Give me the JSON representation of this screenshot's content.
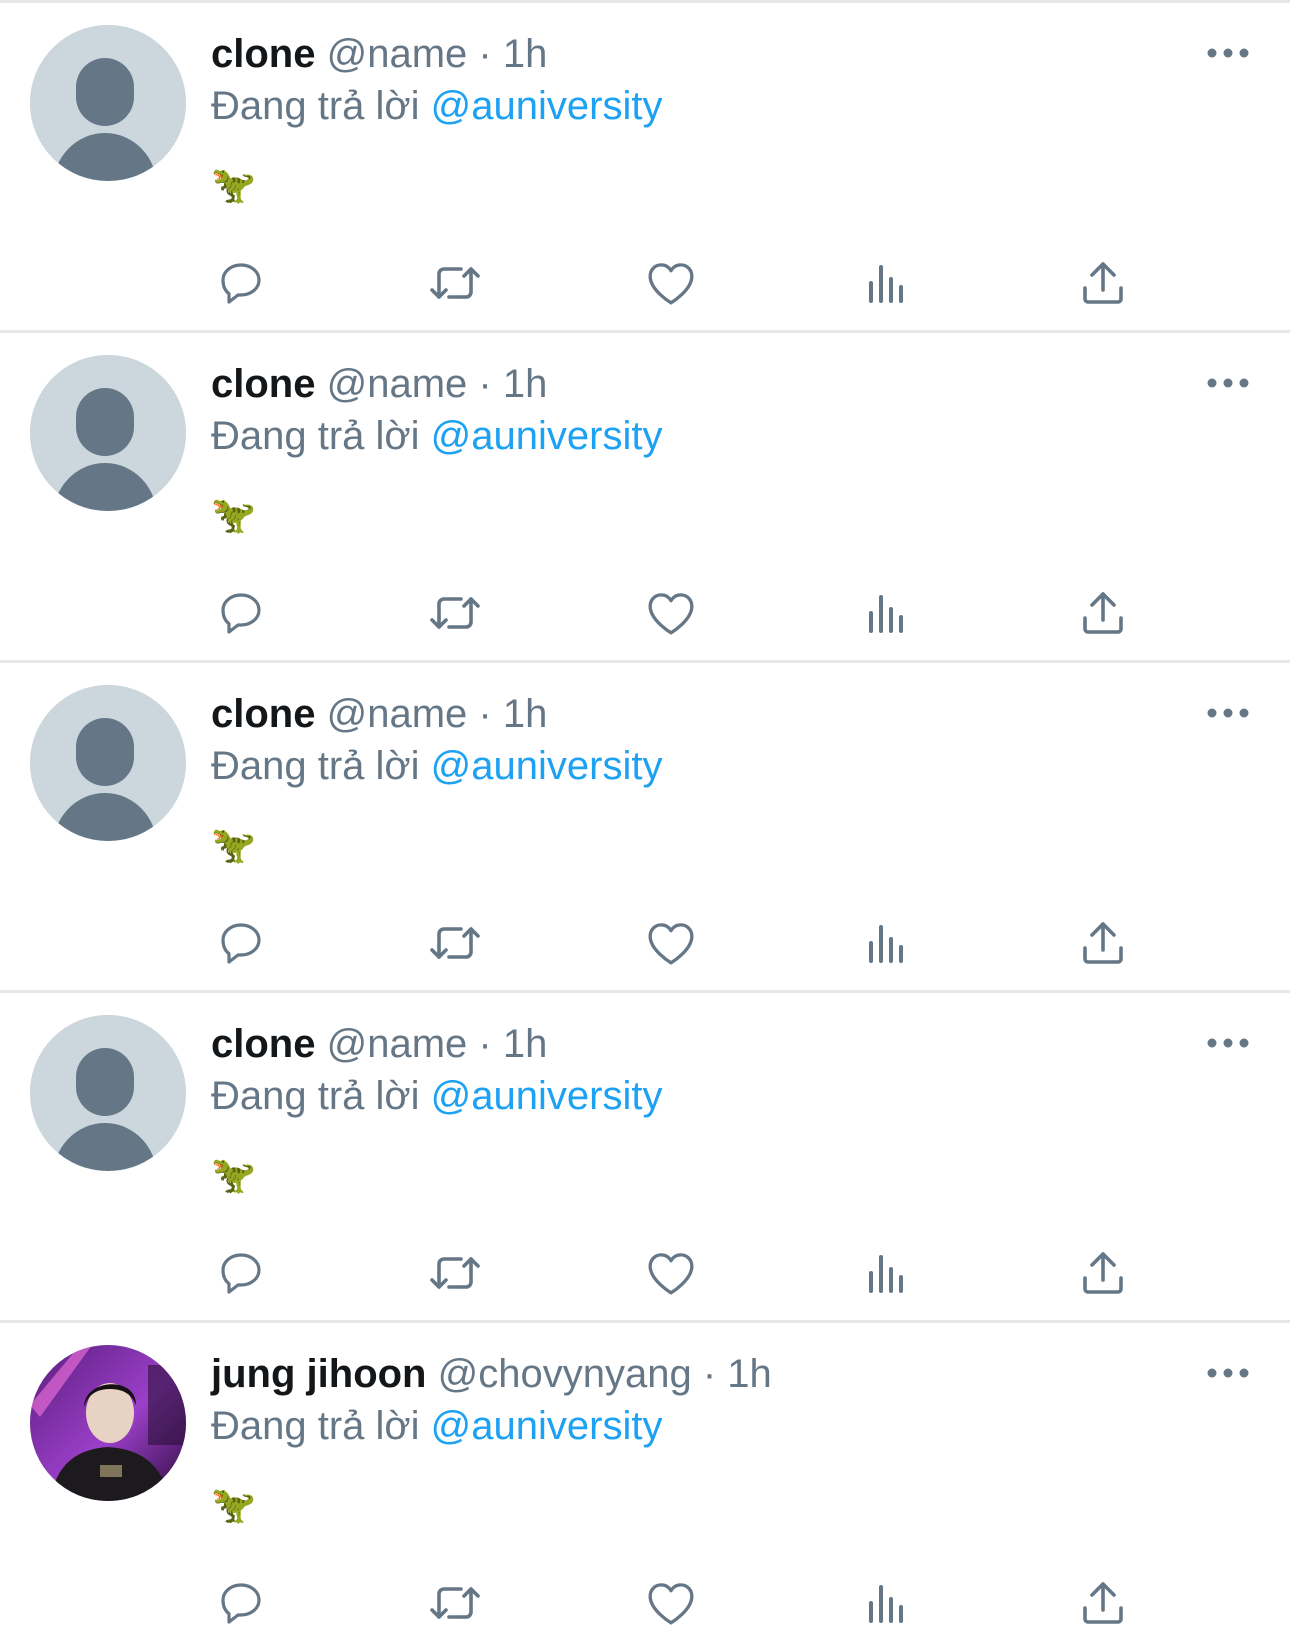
{
  "colors": {
    "text_primary": "#14171a",
    "text_secondary": "#657786",
    "link": "#1da1f2",
    "divider": "#e6e9ec",
    "avatar_placeholder_bg": "#ccd6dd",
    "avatar_placeholder_fg": "#657786"
  },
  "tweets": [
    {
      "display_name": "clone",
      "handle": "@name",
      "separator": "·",
      "time": "1h",
      "reply_prefix": "Đang trả lời",
      "reply_to": "@auniversity",
      "body": "🦖",
      "avatar": "default-profile-avatar"
    },
    {
      "display_name": "clone",
      "handle": "@name",
      "separator": "·",
      "time": "1h",
      "reply_prefix": "Đang trả lời",
      "reply_to": "@auniversity",
      "body": "🦖",
      "avatar": "default-profile-avatar"
    },
    {
      "display_name": "clone",
      "handle": "@name",
      "separator": "·",
      "time": "1h",
      "reply_prefix": "Đang trả lời",
      "reply_to": "@auniversity",
      "body": "🦖",
      "avatar": "default-profile-avatar"
    },
    {
      "display_name": "clone",
      "handle": "@name",
      "separator": "·",
      "time": "1h",
      "reply_prefix": "Đang trả lời",
      "reply_to": "@auniversity",
      "body": "🦖",
      "avatar": "default-profile-avatar"
    },
    {
      "display_name": "jung jihoon",
      "handle": "@chovynyang",
      "separator": "·",
      "time": "1h",
      "reply_prefix": "Đang trả lời",
      "reply_to": "@auniversity",
      "body": "🦖",
      "avatar": "user-photo-avatar"
    }
  ],
  "action_icons": [
    "reply-icon",
    "retweet-icon",
    "like-icon",
    "analytics-icon",
    "share-icon"
  ],
  "more_icon": "more-options-icon"
}
